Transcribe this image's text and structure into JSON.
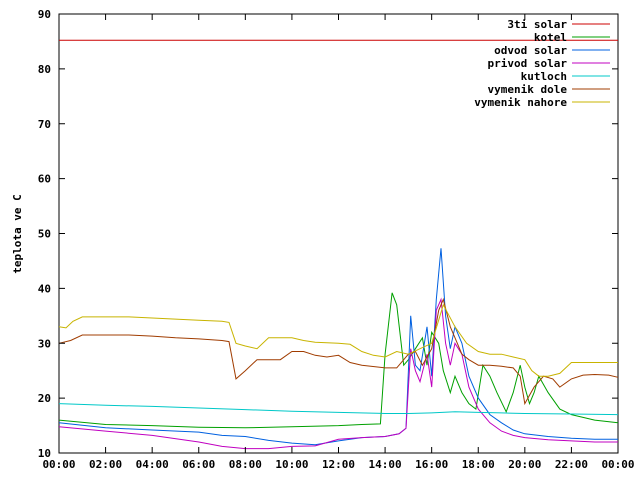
{
  "chart_data": {
    "type": "line",
    "title": "",
    "xlabel": "",
    "ylabel": "teplota ve C",
    "xlim": [
      0,
      24
    ],
    "ylim": [
      10,
      90
    ],
    "grid": false,
    "legend_position": "top-right",
    "x_ticks": [
      "00:00",
      "02:00",
      "04:00",
      "06:00",
      "08:00",
      "10:00",
      "12:00",
      "14:00",
      "16:00",
      "18:00",
      "20:00",
      "22:00",
      "00:00"
    ],
    "y_ticks": [
      10,
      20,
      30,
      40,
      50,
      60,
      70,
      80,
      90
    ],
    "series": [
      {
        "name": "3ti solar",
        "color": "#cc0000",
        "points": [
          [
            0,
            85.2
          ],
          [
            24,
            85.2
          ]
        ]
      },
      {
        "name": "kotel",
        "color": "#00a000",
        "points": [
          [
            0,
            16
          ],
          [
            2,
            15.2
          ],
          [
            4,
            15
          ],
          [
            6,
            14.7
          ],
          [
            8,
            14.6
          ],
          [
            10,
            14.8
          ],
          [
            12,
            15
          ],
          [
            13,
            15.2
          ],
          [
            13.8,
            15.3
          ],
          [
            14.0,
            28
          ],
          [
            14.3,
            39.2
          ],
          [
            14.5,
            37
          ],
          [
            14.8,
            26
          ],
          [
            15.0,
            27
          ],
          [
            15.3,
            29
          ],
          [
            15.6,
            31
          ],
          [
            15.8,
            26
          ],
          [
            16.0,
            32
          ],
          [
            16.3,
            30
          ],
          [
            16.5,
            25
          ],
          [
            16.8,
            21
          ],
          [
            17.0,
            24
          ],
          [
            17.3,
            21
          ],
          [
            17.6,
            19
          ],
          [
            17.9,
            18
          ],
          [
            18.2,
            26
          ],
          [
            18.5,
            24
          ],
          [
            18.8,
            21
          ],
          [
            19.2,
            17.5
          ],
          [
            19.5,
            21
          ],
          [
            19.8,
            26
          ],
          [
            20.0,
            22
          ],
          [
            20.2,
            19
          ],
          [
            20.4,
            21
          ],
          [
            20.6,
            24
          ],
          [
            21.0,
            21
          ],
          [
            21.5,
            18
          ],
          [
            22,
            17
          ],
          [
            23,
            16
          ],
          [
            24,
            15.5
          ]
        ]
      },
      {
        "name": "odvod solar",
        "color": "#0060e0",
        "points": [
          [
            0,
            15.5
          ],
          [
            2,
            14.6
          ],
          [
            4,
            14.2
          ],
          [
            6,
            13.8
          ],
          [
            7,
            13.2
          ],
          [
            8,
            13.0
          ],
          [
            9,
            12.3
          ],
          [
            10,
            11.8
          ],
          [
            11,
            11.5
          ],
          [
            12,
            12.2
          ],
          [
            13,
            12.8
          ],
          [
            14,
            13.0
          ],
          [
            14.6,
            13.5
          ],
          [
            14.9,
            14.5
          ],
          [
            15.1,
            35
          ],
          [
            15.3,
            26
          ],
          [
            15.5,
            25
          ],
          [
            15.8,
            33
          ],
          [
            16.0,
            24
          ],
          [
            16.2,
            38
          ],
          [
            16.4,
            47.3
          ],
          [
            16.6,
            35
          ],
          [
            16.8,
            29
          ],
          [
            17.0,
            33
          ],
          [
            17.3,
            30
          ],
          [
            17.6,
            24
          ],
          [
            18.0,
            20
          ],
          [
            18.5,
            17
          ],
          [
            19.0,
            15.5
          ],
          [
            19.5,
            14.2
          ],
          [
            20.0,
            13.5
          ],
          [
            21,
            13
          ],
          [
            22,
            12.7
          ],
          [
            23,
            12.5
          ],
          [
            24,
            12.5
          ]
        ]
      },
      {
        "name": "privod solar",
        "color": "#c000c0",
        "points": [
          [
            0,
            14.8
          ],
          [
            2,
            14.0
          ],
          [
            4,
            13.2
          ],
          [
            6,
            12.0
          ],
          [
            7,
            11.2
          ],
          [
            8,
            10.8
          ],
          [
            9,
            10.8
          ],
          [
            10,
            11.2
          ],
          [
            11,
            11.3
          ],
          [
            12,
            12.5
          ],
          [
            13,
            12.8
          ],
          [
            14,
            13.0
          ],
          [
            14.6,
            13.5
          ],
          [
            14.9,
            14.5
          ],
          [
            15.1,
            29
          ],
          [
            15.3,
            25
          ],
          [
            15.5,
            23
          ],
          [
            15.8,
            28
          ],
          [
            16.0,
            22
          ],
          [
            16.2,
            36
          ],
          [
            16.4,
            38
          ],
          [
            16.6,
            30
          ],
          [
            16.8,
            26
          ],
          [
            17.0,
            30
          ],
          [
            17.3,
            28
          ],
          [
            17.6,
            22
          ],
          [
            18.0,
            18
          ],
          [
            18.5,
            15.5
          ],
          [
            19.0,
            14.0
          ],
          [
            19.5,
            13.2
          ],
          [
            20.0,
            12.8
          ],
          [
            21,
            12.4
          ],
          [
            22,
            12.2
          ],
          [
            23,
            12.0
          ],
          [
            24,
            12.0
          ]
        ]
      },
      {
        "name": "kutloch",
        "color": "#00c8c8",
        "points": [
          [
            0,
            19
          ],
          [
            2,
            18.7
          ],
          [
            4,
            18.5
          ],
          [
            6,
            18.2
          ],
          [
            8,
            17.9
          ],
          [
            10,
            17.6
          ],
          [
            12,
            17.4
          ],
          [
            14,
            17.2
          ],
          [
            15,
            17.2
          ],
          [
            16,
            17.3
          ],
          [
            17,
            17.5
          ],
          [
            18,
            17.4
          ],
          [
            19,
            17.3
          ],
          [
            20,
            17.2
          ],
          [
            22,
            17.1
          ],
          [
            24,
            17.0
          ]
        ]
      },
      {
        "name": "vymenik dole",
        "color": "#a03c00",
        "points": [
          [
            0,
            30
          ],
          [
            0.5,
            30.5
          ],
          [
            1,
            31.5
          ],
          [
            2,
            31.5
          ],
          [
            3,
            31.5
          ],
          [
            4,
            31.3
          ],
          [
            5,
            31
          ],
          [
            6,
            30.8
          ],
          [
            7,
            30.5
          ],
          [
            7.3,
            30.3
          ],
          [
            7.6,
            23.5
          ],
          [
            8,
            25
          ],
          [
            8.5,
            27
          ],
          [
            9.5,
            27
          ],
          [
            10,
            28.5
          ],
          [
            10.5,
            28.5
          ],
          [
            11,
            27.8
          ],
          [
            11.5,
            27.5
          ],
          [
            12,
            27.8
          ],
          [
            12.5,
            26.5
          ],
          [
            13,
            26.0
          ],
          [
            14,
            25.5
          ],
          [
            14.5,
            25.5
          ],
          [
            15,
            28
          ],
          [
            15.3,
            28.5
          ],
          [
            15.6,
            26
          ],
          [
            16,
            29
          ],
          [
            16.3,
            36
          ],
          [
            16.5,
            38
          ],
          [
            16.8,
            33
          ],
          [
            17,
            31
          ],
          [
            17.3,
            28
          ],
          [
            17.6,
            27
          ],
          [
            18,
            26
          ],
          [
            18.5,
            26
          ],
          [
            19,
            25.8
          ],
          [
            19.5,
            25.5
          ],
          [
            19.8,
            24
          ],
          [
            20.0,
            19
          ],
          [
            20.4,
            22
          ],
          [
            20.8,
            24
          ],
          [
            21.2,
            23.5
          ],
          [
            21.5,
            22
          ],
          [
            22,
            23.5
          ],
          [
            22.5,
            24.2
          ],
          [
            23,
            24.3
          ],
          [
            23.6,
            24.2
          ],
          [
            24,
            23.8
          ]
        ]
      },
      {
        "name": "vymenik nahore",
        "color": "#c8b400",
        "points": [
          [
            0,
            33
          ],
          [
            0.3,
            32.8
          ],
          [
            0.6,
            34
          ],
          [
            1,
            34.8
          ],
          [
            2,
            34.8
          ],
          [
            3,
            34.8
          ],
          [
            4,
            34.6
          ],
          [
            5,
            34.4
          ],
          [
            6,
            34.2
          ],
          [
            7,
            34
          ],
          [
            7.3,
            33.8
          ],
          [
            7.6,
            30
          ],
          [
            8,
            29.5
          ],
          [
            8.5,
            29.0
          ],
          [
            9,
            31
          ],
          [
            10,
            31
          ],
          [
            10.5,
            30.5
          ],
          [
            11,
            30.2
          ],
          [
            12,
            30.0
          ],
          [
            12.5,
            29.8
          ],
          [
            13,
            28.5
          ],
          [
            13.5,
            27.8
          ],
          [
            14,
            27.5
          ],
          [
            14.5,
            28.5
          ],
          [
            15,
            28.0
          ],
          [
            15.5,
            29
          ],
          [
            16,
            30
          ],
          [
            16.5,
            37
          ],
          [
            17,
            33
          ],
          [
            17.5,
            30
          ],
          [
            18,
            28.5
          ],
          [
            18.5,
            28.0
          ],
          [
            19,
            28.0
          ],
          [
            19.5,
            27.5
          ],
          [
            20,
            27
          ],
          [
            20.3,
            25
          ],
          [
            20.6,
            24
          ],
          [
            21,
            24
          ],
          [
            21.5,
            24.5
          ],
          [
            22,
            26.5
          ],
          [
            23,
            26.5
          ],
          [
            24,
            26.5
          ]
        ]
      }
    ]
  }
}
